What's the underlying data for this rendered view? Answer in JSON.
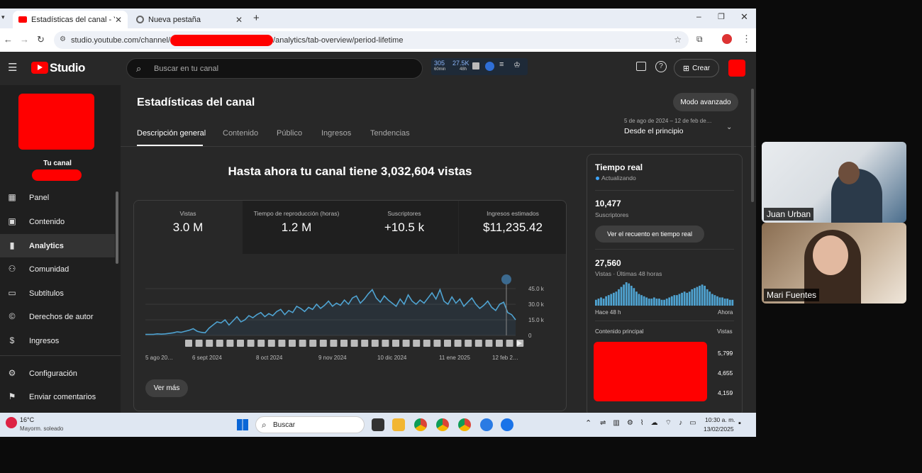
{
  "browser": {
    "tabs": [
      {
        "title": "Estadísticas del canal - YouTube",
        "active": true
      },
      {
        "title": "Nueva pestaña",
        "active": false
      }
    ],
    "url_prefix": "studio.youtube.com/channel/",
    "url_suffix": "/analytics/tab-overview/period-lifetime"
  },
  "studio": {
    "logo_text": "Studio",
    "search_placeholder": "Buscar en tu canal",
    "ext_stats": {
      "v1": "305",
      "v1_sub": "60min",
      "v2": "27.5K",
      "v2_sub": "48h"
    },
    "create_label": "Crear",
    "sidebar": {
      "channel_label": "Tu canal",
      "items": [
        {
          "label": "Panel",
          "icon": "dashboard-icon"
        },
        {
          "label": "Contenido",
          "icon": "content-icon"
        },
        {
          "label": "Analytics",
          "icon": "analytics-icon",
          "active": true
        },
        {
          "label": "Comunidad",
          "icon": "community-icon"
        },
        {
          "label": "Subtítulos",
          "icon": "subtitles-icon"
        },
        {
          "label": "Derechos de autor",
          "icon": "copyright-icon"
        },
        {
          "label": "Ingresos",
          "icon": "dollar-icon"
        },
        {
          "label": "Configuración",
          "icon": "gear-icon"
        },
        {
          "label": "Enviar comentarios",
          "icon": "feedback-icon"
        }
      ]
    },
    "page_title": "Estadísticas del canal",
    "advanced_mode": "Modo avanzado",
    "tabs": [
      "Descripción general",
      "Contenido",
      "Público",
      "Ingresos",
      "Tendencias"
    ],
    "date_range": {
      "range": "5 de ago de 2024 – 12 de feb de…",
      "label": "Desde el principio"
    },
    "headline": "Hasta ahora tu canal tiene 3,032,604 vistas",
    "metrics": [
      {
        "label": "Vistas",
        "value": "3.0 M"
      },
      {
        "label": "Tiempo de reproducción (horas)",
        "value": "1.2 M"
      },
      {
        "label": "Suscriptores",
        "value": "+10.5 k"
      },
      {
        "label": "Ingresos estimados",
        "value": "$11,235.42"
      }
    ],
    "see_more": "Ver más",
    "realtime": {
      "title": "Tiempo real",
      "status": "Actualizando",
      "subscribers": "10,477",
      "subscribers_label": "Suscriptores",
      "count_button": "Ver el recuento en tiempo real",
      "views": "27,560",
      "views_label": "Vistas · Últimas 48 horas",
      "axis_start": "Hace 48 h",
      "axis_end": "Ahora",
      "top_content_label": "Contenido principal",
      "views_col": "Vistas",
      "top_views": [
        "5,799",
        "4,655",
        "4,159"
      ],
      "bars": [
        0.25,
        0.3,
        0.35,
        0.3,
        0.4,
        0.45,
        0.5,
        0.55,
        0.6,
        0.7,
        0.8,
        0.9,
        1.0,
        0.95,
        0.85,
        0.75,
        0.6,
        0.5,
        0.45,
        0.4,
        0.35,
        0.3,
        0.3,
        0.35,
        0.3,
        0.3,
        0.25,
        0.25,
        0.3,
        0.35,
        0.4,
        0.45,
        0.45,
        0.5,
        0.55,
        0.6,
        0.55,
        0.6,
        0.7,
        0.75,
        0.8,
        0.85,
        0.9,
        0.85,
        0.7,
        0.6,
        0.5,
        0.45,
        0.4,
        0.35,
        0.35,
        0.3,
        0.3,
        0.25,
        0.25
      ]
    }
  },
  "chart_data": {
    "type": "line",
    "yticks": [
      "45.0 k",
      "30.0 k",
      "15.0 k",
      "0"
    ],
    "ylim": [
      0,
      45000
    ],
    "xticks": [
      "5 ago 20…",
      "6 sept 2024",
      "8 oct 2024",
      "9 nov 2024",
      "10 dic 2024",
      "11 ene 2025",
      "12 feb 2…"
    ],
    "series": [
      {
        "values": [
          1000,
          1000,
          1000,
          1500,
          1200,
          1500,
          2000,
          2500,
          3500,
          3000,
          4000,
          5000,
          6500,
          4000,
          3000,
          2500,
          7000,
          10000,
          13000,
          12000,
          15000,
          10000,
          14000,
          18000,
          13000,
          15000,
          19000,
          17000,
          20000,
          22000,
          18000,
          21000,
          19000,
          23000,
          25000,
          20000,
          24000,
          22000,
          28000,
          26000,
          23000,
          27000,
          25000,
          30000,
          26000,
          29000,
          33000,
          28000,
          31000,
          29000,
          34000,
          30000,
          36000,
          38000,
          31000,
          35000,
          40000,
          44000,
          36000,
          32000,
          38000,
          34000,
          31000,
          28000,
          35000,
          30000,
          39000,
          33000,
          30000,
          34000,
          31000,
          36000,
          41000,
          35000,
          44000,
          33000,
          30000,
          37000,
          31000,
          35000,
          28000,
          32000,
          36000,
          30000,
          26000,
          29000,
          33000,
          27000,
          24000,
          30000,
          32000,
          22000,
          20000,
          15000
        ]
      }
    ]
  },
  "taskbar": {
    "weather_temp": "16°C",
    "weather_text": "Mayorm. soleado",
    "search": "Buscar",
    "time": "10:30 a. m.",
    "date": "13/02/2025"
  },
  "participants": [
    {
      "name": "Juan Urban"
    },
    {
      "name": "Mari Fuentes"
    }
  ]
}
